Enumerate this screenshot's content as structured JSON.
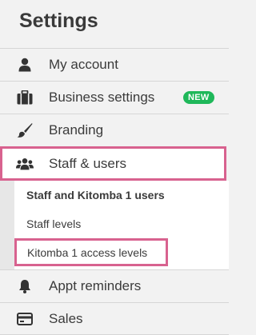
{
  "page": {
    "title": "Settings"
  },
  "menu": {
    "items": [
      {
        "label": "My account",
        "icon": "user-icon"
      },
      {
        "label": "Business settings",
        "icon": "briefcase-icon",
        "badge": "NEW"
      },
      {
        "label": "Branding",
        "icon": "paintbrush-icon"
      },
      {
        "label": "Staff & users",
        "icon": "users-icon"
      },
      {
        "label": "Appt reminders",
        "icon": "bell-icon"
      },
      {
        "label": "Sales",
        "icon": "credit-card-icon"
      }
    ],
    "submenu": [
      {
        "label": "Staff and Kitomba 1 users"
      },
      {
        "label": "Staff levels"
      },
      {
        "label": "Kitomba 1 access levels"
      }
    ]
  },
  "colors": {
    "highlight_border": "#d8628f",
    "badge_green": "#1fb85a",
    "background": "#f2f2f2"
  }
}
